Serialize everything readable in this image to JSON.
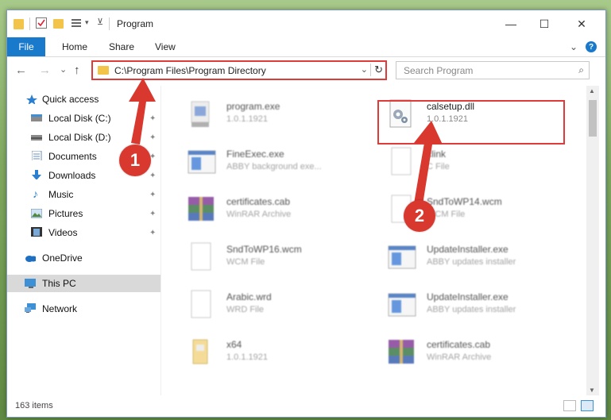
{
  "window": {
    "title": "Program",
    "controls": {
      "minimize": "—",
      "maximize": "☐",
      "close": "✕"
    }
  },
  "ribbon": {
    "file": "File",
    "tabs": [
      "Home",
      "Share",
      "View"
    ],
    "expand": "⌄",
    "help": "?"
  },
  "navbar": {
    "back": "←",
    "forward": "→",
    "recent": "⌄",
    "up": "↑",
    "address": "C:\\Program Files\\Program Directory",
    "address_dropdown": "⌄",
    "refresh": "↻",
    "search_placeholder": "Search Program",
    "search_icon": "⌕"
  },
  "sidebar": {
    "items": [
      {
        "label": "Quick access",
        "icon": "star-icon",
        "pinned": false
      },
      {
        "label": "Local Disk (C:)",
        "icon": "drive-icon",
        "pinned": true
      },
      {
        "label": "Local Disk (D:)",
        "icon": "drive-icon",
        "pinned": true
      },
      {
        "label": "Documents",
        "icon": "documents-icon",
        "pinned": true
      },
      {
        "label": "Downloads",
        "icon": "download-icon",
        "pinned": true
      },
      {
        "label": "Music",
        "icon": "music-icon",
        "pinned": true
      },
      {
        "label": "Pictures",
        "icon": "pictures-icon",
        "pinned": true
      },
      {
        "label": "Videos",
        "icon": "videos-icon",
        "pinned": true
      },
      {
        "label": "OneDrive",
        "icon": "cloud-icon",
        "pinned": false
      },
      {
        "label": "This PC",
        "icon": "computer-icon",
        "pinned": false,
        "selected": true
      },
      {
        "label": "Network",
        "icon": "network-icon",
        "pinned": false
      }
    ],
    "pin_glyph": "📌"
  },
  "files": [
    {
      "name": "program.exe",
      "desc": "1.0.1.1921",
      "icon": "exe-icon"
    },
    {
      "name": "calsetup.dll",
      "desc": "1.0.1.1921",
      "icon": "dll-gear-icon"
    },
    {
      "name": "FineExec.exe",
      "desc": "ABBY background exe...",
      "icon": "app-window-icon"
    },
    {
      "name": "clink",
      "desc": "C File",
      "icon": "blank-file-icon"
    },
    {
      "name": "certificates.cab",
      "desc": "WinRAR Archive",
      "icon": "winrar-icon"
    },
    {
      "name": "SndToWP14.wcm",
      "desc": "WCM File",
      "icon": "blank-file-icon"
    },
    {
      "name": "SndToWP16.wcm",
      "desc": "WCM File",
      "icon": "blank-file-icon"
    },
    {
      "name": "UpdateInstaller.exe",
      "desc": "ABBY updates installer",
      "icon": "app-window-icon"
    },
    {
      "name": "Arabic.wrd",
      "desc": "WRD File",
      "icon": "blank-file-icon"
    },
    {
      "name": "UpdateInstaller.exe",
      "desc": "ABBY updates installer",
      "icon": "app-window-icon"
    },
    {
      "name": "x64",
      "desc": "1.0.1.1921",
      "icon": "exe-icon"
    },
    {
      "name": "certificates.cab",
      "desc": "WinRAR Archive",
      "icon": "winrar-icon"
    }
  ],
  "status": {
    "item_count": "163 items"
  },
  "annotations": {
    "step1": "1",
    "step2": "2"
  },
  "colors": {
    "accent": "#1979ca",
    "highlight": "#e03b3b",
    "folder": "#f2c54a"
  }
}
